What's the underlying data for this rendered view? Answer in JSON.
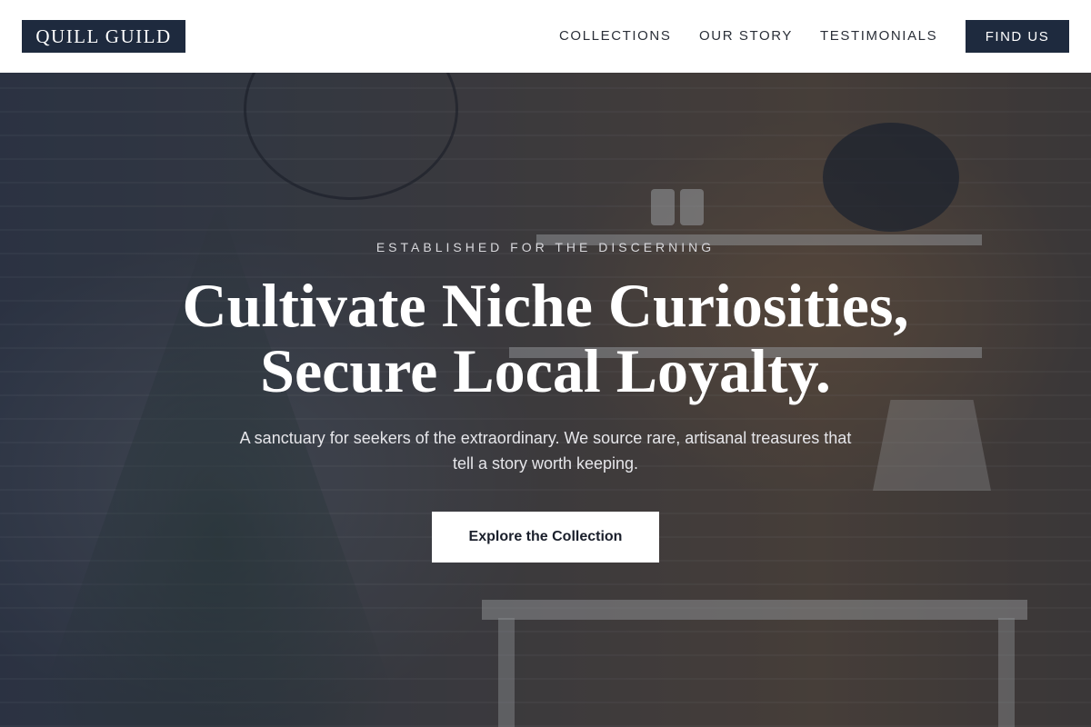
{
  "brand": {
    "logo_text": "QUILL GUILD"
  },
  "nav": {
    "items": [
      {
        "label": "COLLECTIONS"
      },
      {
        "label": "OUR STORY"
      },
      {
        "label": "TESTIMONIALS"
      }
    ],
    "cta_label": "FIND US"
  },
  "hero": {
    "eyebrow": "ESTABLISHED FOR THE DISCERNING",
    "headline_line1": "Cultivate Niche Curiosities,",
    "headline_line2": "Secure Local Loyalty.",
    "subtext": "A sanctuary for seekers of the extraordinary. We source rare, artisanal treasures that tell a story worth keeping.",
    "cta_label": "Explore the Collection"
  },
  "colors": {
    "brand_navy": "#1e2a3e",
    "header_bg": "#ffffff",
    "hero_text": "#ffffff"
  }
}
